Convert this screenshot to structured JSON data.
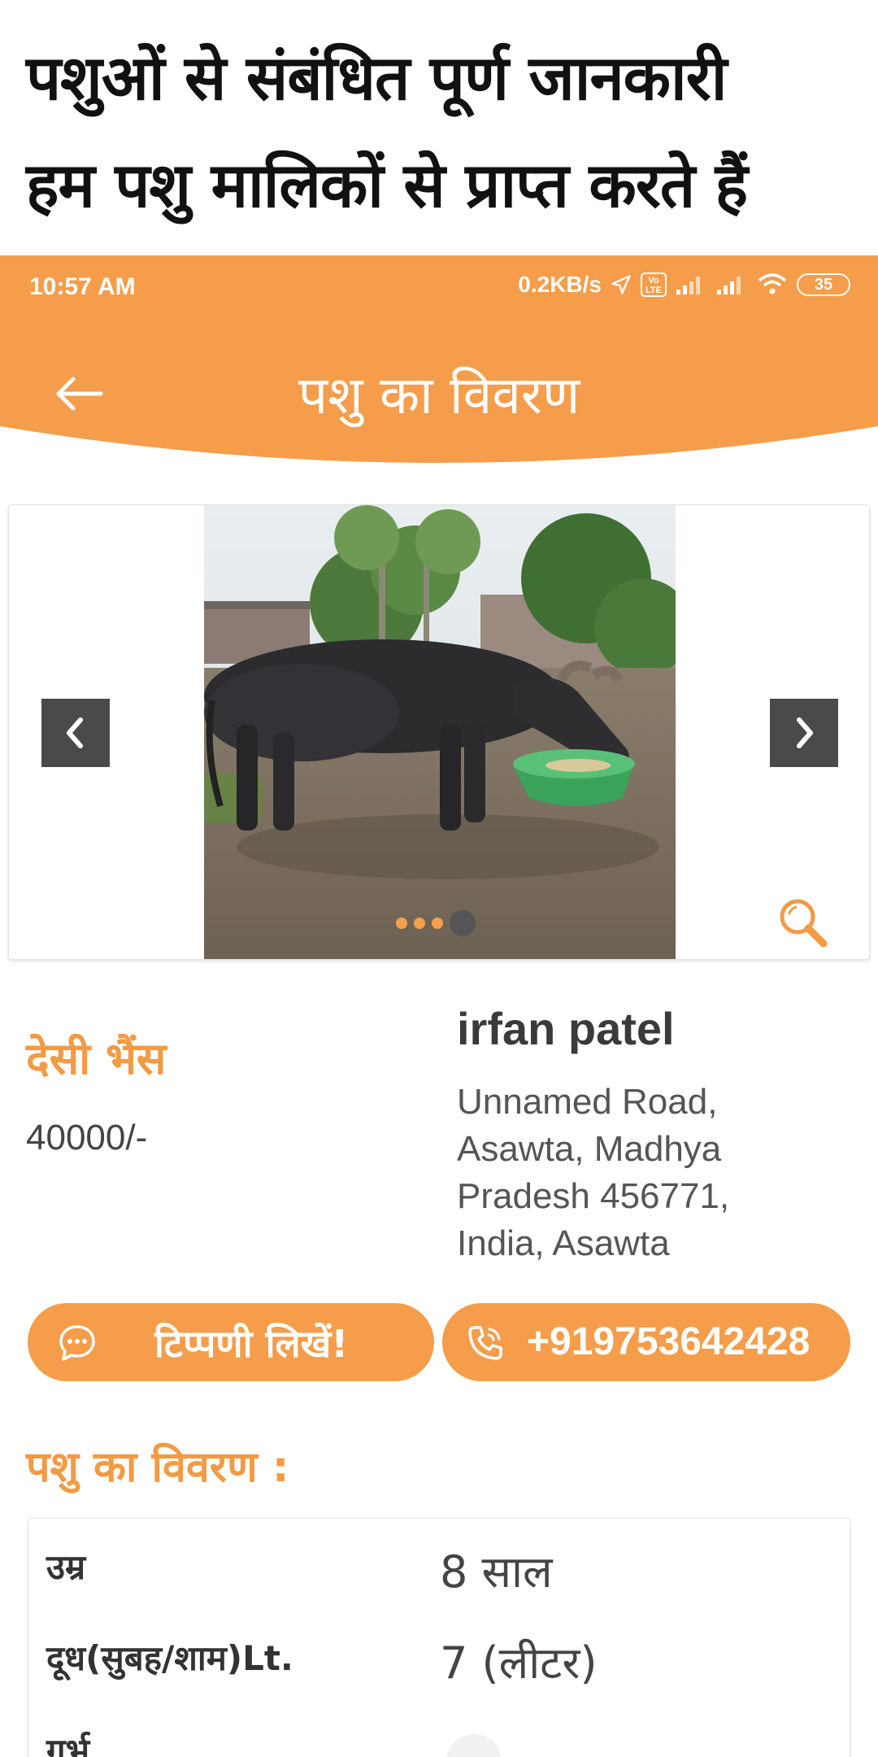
{
  "promo": {
    "line1": "पशुओं से संबंधित पूर्ण जानकारी",
    "line2": "हम पशु मालिकों से प्राप्त करते हैं"
  },
  "status_bar": {
    "time": "10:57 AM",
    "network_speed": "0.2KB/s",
    "volte_top": "Vo",
    "volte_bottom": "LTE",
    "battery": "35"
  },
  "header": {
    "title": "पशु का विवरण",
    "back_icon": "arrow-left-icon",
    "color": "#f59d4b"
  },
  "carousel": {
    "total_images": 4,
    "active_index": 3,
    "prev_icon": "chevron-left-icon",
    "next_icon": "chevron-right-icon",
    "zoom_icon": "magnifier-icon"
  },
  "listing": {
    "animal_name": "देसी भैंस",
    "price": "40000/-",
    "owner_name": "irfan patel",
    "address": "Unnamed Road, Asawta, Madhya Pradesh 456771, India, Asawta"
  },
  "actions": {
    "comment_label": "टिप्पणी लिखें!",
    "comment_icon": "chat-bubble-icon",
    "call_label": "+919753642428",
    "call_icon": "phone-icon"
  },
  "details": {
    "section_title": "पशु का विवरण :",
    "rows": [
      {
        "label": "उम्र",
        "value": "8 साल"
      },
      {
        "label": "दूध(सुबह/शाम)Lt.",
        "value": "7 (लीटर)"
      },
      {
        "label": "गर्भ",
        "value": ""
      }
    ]
  },
  "colors": {
    "accent": "#f59d4b",
    "accent_text": "#f39a44",
    "arrow_bg": "#4a4a4a"
  }
}
